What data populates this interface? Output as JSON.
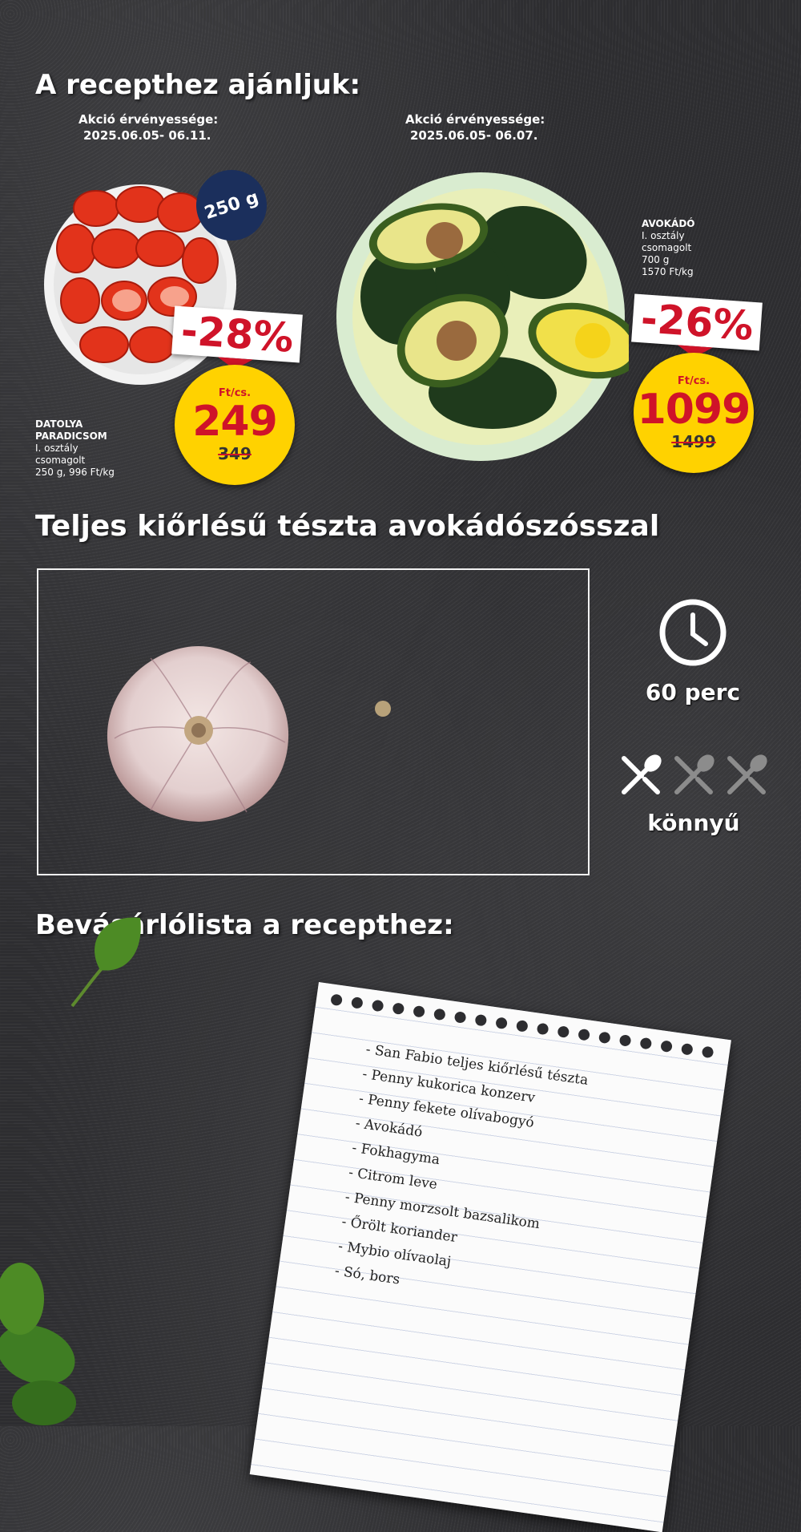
{
  "top": {
    "heading": "A recepthez ajánljuk:",
    "left_validity_label": "Akció érvényessége:",
    "left_validity_dates": "2025.06.05- 06.11.",
    "right_validity_label": "Akció érvényessége:",
    "right_validity_dates": "2025.06.05- 06.07."
  },
  "tomato": {
    "weight_badge": "250 g",
    "discount": "-28%",
    "unit": "Ft/cs.",
    "price": "249",
    "old_price": "349",
    "name_line1": "DATOLYA",
    "name_line2": "PARADICSOM",
    "detail_1": "I. osztály",
    "detail_2": "csomagolt",
    "detail_3": "250 g, 996 Ft/kg"
  },
  "avocado": {
    "name": "AVOKÁDÓ",
    "detail_1": "I. osztály",
    "detail_2": "csomagolt",
    "detail_3": "700 g",
    "detail_4": "1570 Ft/kg",
    "discount": "-26%",
    "unit": "Ft/cs.",
    "price": "1099",
    "old_price": "1499"
  },
  "recipe": {
    "title": "Teljes kiőrlésű tészta avokádószósszal",
    "time": "60 perc",
    "difficulty": "könnyű",
    "difficulty_level": 1,
    "difficulty_max": 3
  },
  "shopping": {
    "heading": "Bevásárlólista a recepthez:",
    "items": [
      "- San Fabio teljes kiőrlésű tészta",
      "- Penny kukorica konzerv",
      "- Penny fekete olívabogyó",
      "- Avokádó",
      "- Fokhagyma",
      "- Citrom leve",
      "- Penny morzsolt bazsalikom",
      "- Őrölt koriander",
      "- Mybio olívaolaj",
      "- Só, bors"
    ]
  },
  "colors": {
    "accent_red": "#cf1329",
    "price_yellow": "#ffd200",
    "badge_navy": "#1b2f5c",
    "background": "#2d2d30"
  },
  "icons": [
    "clock-icon",
    "spoon-fork-icon"
  ]
}
